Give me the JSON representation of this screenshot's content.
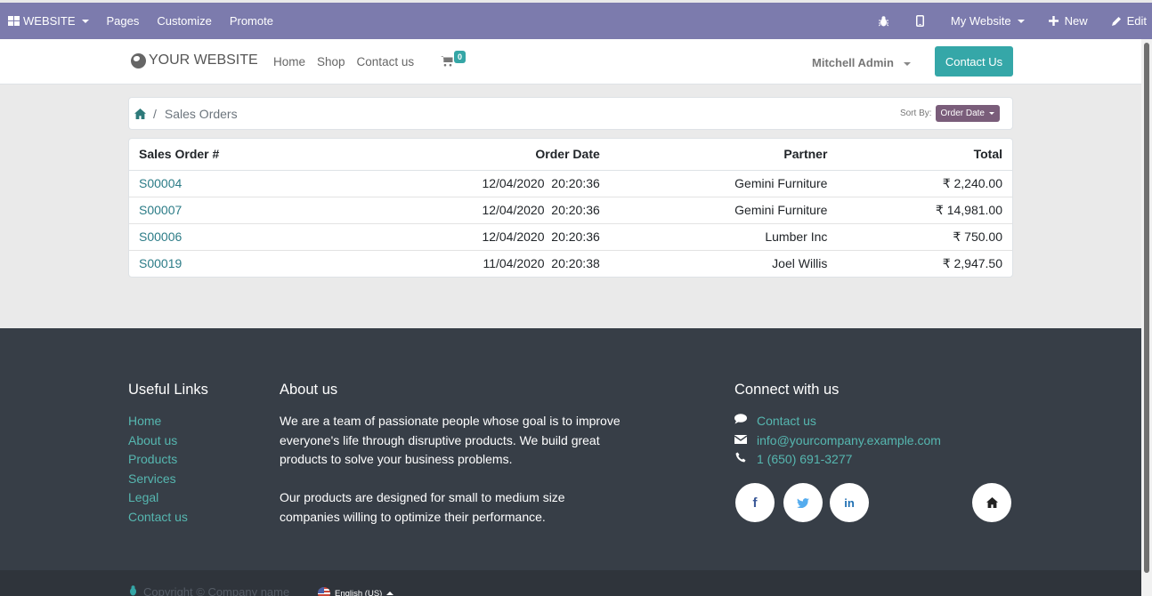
{
  "admin_bar": {
    "brand_label": "WEBSITE",
    "menu": [
      "Pages",
      "Customize",
      "Promote"
    ],
    "website_selector": "My Website",
    "new_label": "New",
    "edit_label": "Edit",
    "color": "#7c7bad"
  },
  "header": {
    "logo_text": "YOUR WEBSITE",
    "nav": [
      "Home",
      "Shop",
      "Contact us"
    ],
    "cart_count": "0",
    "user_name": "Mitchell Admin",
    "contact_button": "Contact Us",
    "accent_color": "#35a7a8"
  },
  "breadcrumb": {
    "current": "Sales Orders",
    "sort_label": "Sort By:",
    "sort_value": "Order Date"
  },
  "orders": {
    "columns": [
      "Sales Order #",
      "Order Date",
      "Partner",
      "Total"
    ],
    "rows": [
      {
        "number": "S00004",
        "date": "12/04/2020  20:20:36",
        "partner": "Gemini Furniture",
        "total": "₹ 2,240.00"
      },
      {
        "number": "S00007",
        "date": "12/04/2020  20:20:36",
        "partner": "Gemini Furniture",
        "total": "₹ 14,981.00"
      },
      {
        "number": "S00006",
        "date": "12/04/2020  20:20:36",
        "partner": "Lumber Inc",
        "total": "₹ 750.00"
      },
      {
        "number": "S00019",
        "date": "11/04/2020  20:20:38",
        "partner": "Joel Willis",
        "total": "₹ 2,947.50"
      }
    ]
  },
  "footer": {
    "useful_links_title": "Useful Links",
    "useful_links": [
      "Home",
      "About us",
      "Products",
      "Services",
      "Legal",
      "Contact us"
    ],
    "about_title": "About us",
    "about_paragraphs": [
      "We are a team of passionate people whose goal is to improve everyone's life through disruptive products. We build great products to solve your business problems.",
      "Our products are designed for small to medium size companies willing to optimize their performance."
    ],
    "connect_title": "Connect with us",
    "connect": {
      "contact": "Contact us",
      "email": "info@yourcompany.example.com",
      "phone": "1 (650) 691-3277"
    },
    "socials": [
      "facebook",
      "twitter",
      "linkedin",
      "home"
    ]
  },
  "copyright": {
    "text": "Copyright © Company name",
    "language": "English (US)"
  }
}
